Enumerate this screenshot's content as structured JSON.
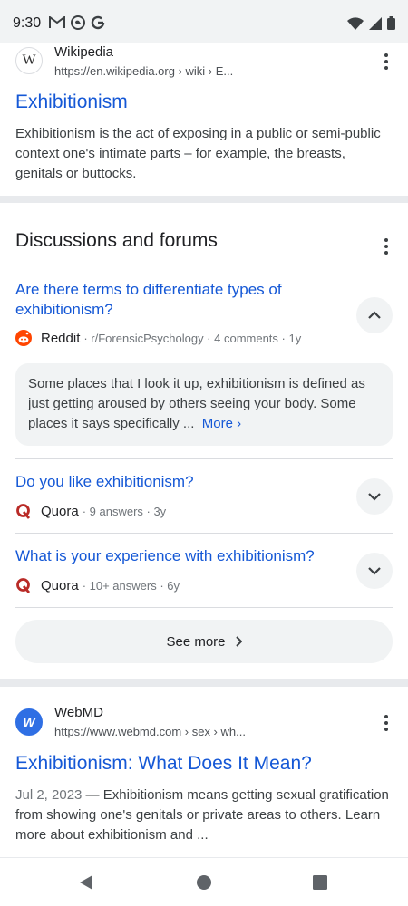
{
  "status_bar": {
    "time": "9:30",
    "left_icons": [
      "gmail-icon",
      "location-icon",
      "google-icon"
    ],
    "right_icons": [
      "wifi-icon",
      "signal-icon",
      "battery-icon"
    ]
  },
  "wiki_result": {
    "logo_letter": "W",
    "source": "Wikipedia",
    "url": "https://en.wikipedia.org › wiki › E...",
    "title": "Exhibitionism",
    "snippet": "Exhibitionism is the act of exposing in a public or semi-public context one's intimate parts – for example, the breasts, genitals or buttocks."
  },
  "discussions": {
    "heading": "Discussions and forums",
    "items": [
      {
        "question": "Are there terms to differentiate types of exhibitionism?",
        "site": "Reddit",
        "meta": "· r/ForensicPsychology · 4 comments · 1y",
        "expanded": true,
        "excerpt": "Some places that I look it up, exhibitionism is defined as just getting aroused by others seeing your body. Some places it says specifically ...",
        "more_label": "More"
      },
      {
        "question": "Do you like exhibitionism?",
        "site": "Quora",
        "meta": "· 9 answers · 3y",
        "expanded": false
      },
      {
        "question": "What is your experience with exhibitionism?",
        "site": "Quora",
        "meta": "· 10+ answers · 6y",
        "expanded": false
      }
    ],
    "see_more_label": "See more"
  },
  "webmd_result": {
    "logo_letter": "W",
    "source": "WebMD",
    "url": "https://www.webmd.com › sex › wh...",
    "title": "Exhibitionism: What Does It Mean?",
    "date": "Jul 2, 2023",
    "snippet": " — Exhibitionism means getting sexual gratification from showing one's genitals or private areas to others. Learn more about exhibitionism and ..."
  },
  "colors": {
    "link": "#1558d6",
    "reddit": "#ff4500",
    "quora": "#b92b27",
    "webmd": "#2f6fe4"
  }
}
